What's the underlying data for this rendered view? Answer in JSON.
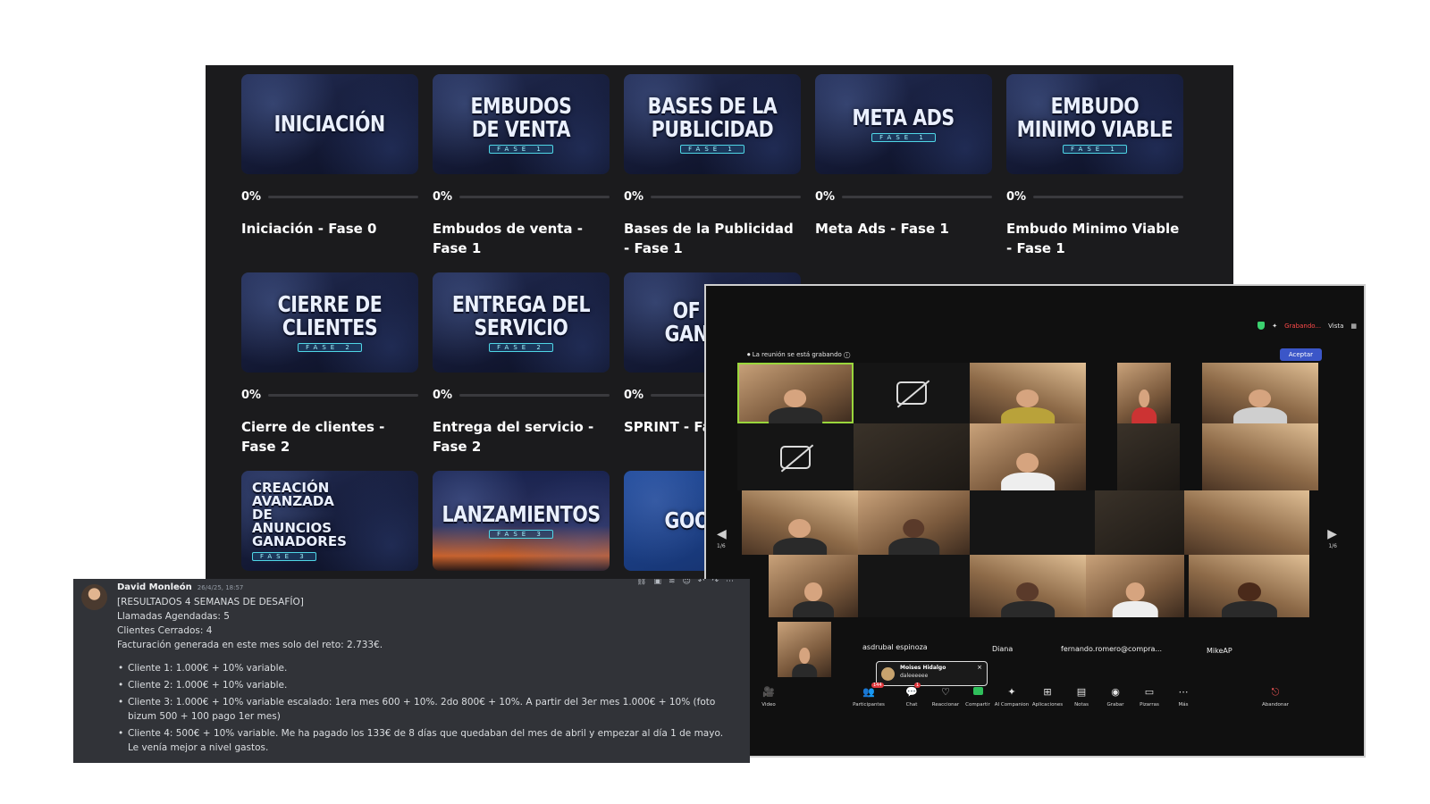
{
  "courses": [
    {
      "thumb": "INICIACIÓN",
      "badge": "",
      "percent": "0%",
      "progress": 0,
      "name": "Iniciación - Fase 0"
    },
    {
      "thumb": "EMBUDOS DE VENTA",
      "badge": "FASE 1",
      "percent": "0%",
      "progress": 0,
      "name": "Embudos de venta - Fase 1"
    },
    {
      "thumb": "BASES DE LA PUBLICIDAD",
      "badge": "FASE 1",
      "percent": "0%",
      "progress": 0,
      "name": "Bases de la Publicidad - Fase 1"
    },
    {
      "thumb": "META ADS",
      "badge": "FASE 1",
      "percent": "0%",
      "progress": 0,
      "name": "Meta Ads - Fase 1"
    },
    {
      "thumb": "EMBUDO MINIMO VIABLE",
      "badge": "FASE 1",
      "percent": "0%",
      "progress": 0,
      "name": "Embudo Minimo Viable - Fase 1"
    },
    {
      "thumb": "CIERRE DE CLIENTES",
      "badge": "FASE 2",
      "percent": "0%",
      "progress": 0,
      "name": "Cierre de clientes - Fase 2"
    },
    {
      "thumb": "ENTREGA DEL SERVICIO",
      "badge": "FASE 2",
      "percent": "0%",
      "progress": 0,
      "name": "Entrega del servicio - Fase 2"
    },
    {
      "thumb": "OF GAN",
      "badge": "",
      "percent": "0%",
      "progress": 0,
      "name": "SPRINT - Fa"
    },
    {
      "thumb": "CREACIÓN AVANZADA DE ANUNCIOS GANADORES",
      "badge": "FASE 3",
      "percent": "",
      "progress": 0,
      "name": ""
    },
    {
      "thumb": "LANZAMIENTOS",
      "badge": "FASE 3",
      "percent": "",
      "progress": 0,
      "name": ""
    },
    {
      "thumb": "GOO",
      "badge": "",
      "percent": "",
      "progress": 0,
      "name": ""
    }
  ],
  "zoom": {
    "top_status": {
      "recording": "Grabando...",
      "view": "Vista"
    },
    "rec_banner": "La reunión se está grabando",
    "accept_label": "Aceptar",
    "page_indicator": "1/6",
    "participant_names": [
      "asdrubal espinoza",
      "Diana",
      "fernando.romero@compra...",
      "MikeAP"
    ],
    "chat_toast": {
      "sender": "Moises Hidalgo",
      "text": "daleeeeee",
      "close": "×"
    },
    "toolbar": [
      {
        "icon": "video-icon",
        "glyph": "🎥",
        "label": "Video"
      },
      {
        "icon": "participants-icon",
        "glyph": "👥",
        "label": "Participantes",
        "badge": "144"
      },
      {
        "icon": "chat-icon",
        "glyph": "💬",
        "label": "Chat",
        "badge": "1"
      },
      {
        "icon": "react-icon",
        "glyph": "♡",
        "label": "Reaccionar"
      },
      {
        "icon": "share-icon",
        "glyph": "▲",
        "label": "Compartir"
      },
      {
        "icon": "ai-companion-icon",
        "glyph": "✦",
        "label": "AI Companion"
      },
      {
        "icon": "apps-icon",
        "glyph": "⊞",
        "label": "Aplicaciones"
      },
      {
        "icon": "notes-icon",
        "glyph": "▤",
        "label": "Notas"
      },
      {
        "icon": "record-icon",
        "glyph": "◉",
        "label": "Grabar"
      },
      {
        "icon": "whiteboard-icon",
        "glyph": "▭",
        "label": "Pizarras"
      },
      {
        "icon": "more-icon",
        "glyph": "⋯",
        "label": "Más"
      },
      {
        "icon": "leave-icon",
        "glyph": "⎋",
        "label": "Abandonar"
      }
    ]
  },
  "message": {
    "author": "David Monleón",
    "timestamp": "26/4/25, 18:57",
    "lines": [
      "[RESULTADOS 4 SEMANAS DE DESAFÍO]",
      "Llamadas Agendadas: 5",
      "Clientes Cerrados: 4",
      "Facturación generada en este mes solo del reto: 2.733€."
    ],
    "bullets": [
      "Cliente 1: 1.000€ + 10% variable.",
      "Cliente 2: 1.000€ + 10% variable.",
      "Cliente 3: 1.000€ + 10% variable escalado:  1era mes 600 + 10%. 2do 800€ + 10%. A partir del 3er mes 1.000€ + 10% (foto bizum 500 + 100 pago 1er mes)",
      "Cliente 4: 500€ + 10% variable. Me ha pagado los 133€ de 8 días que quedaban del mes de abril y empezar al día 1 de mayo. Le venía mejor a nivel gastos."
    ]
  }
}
